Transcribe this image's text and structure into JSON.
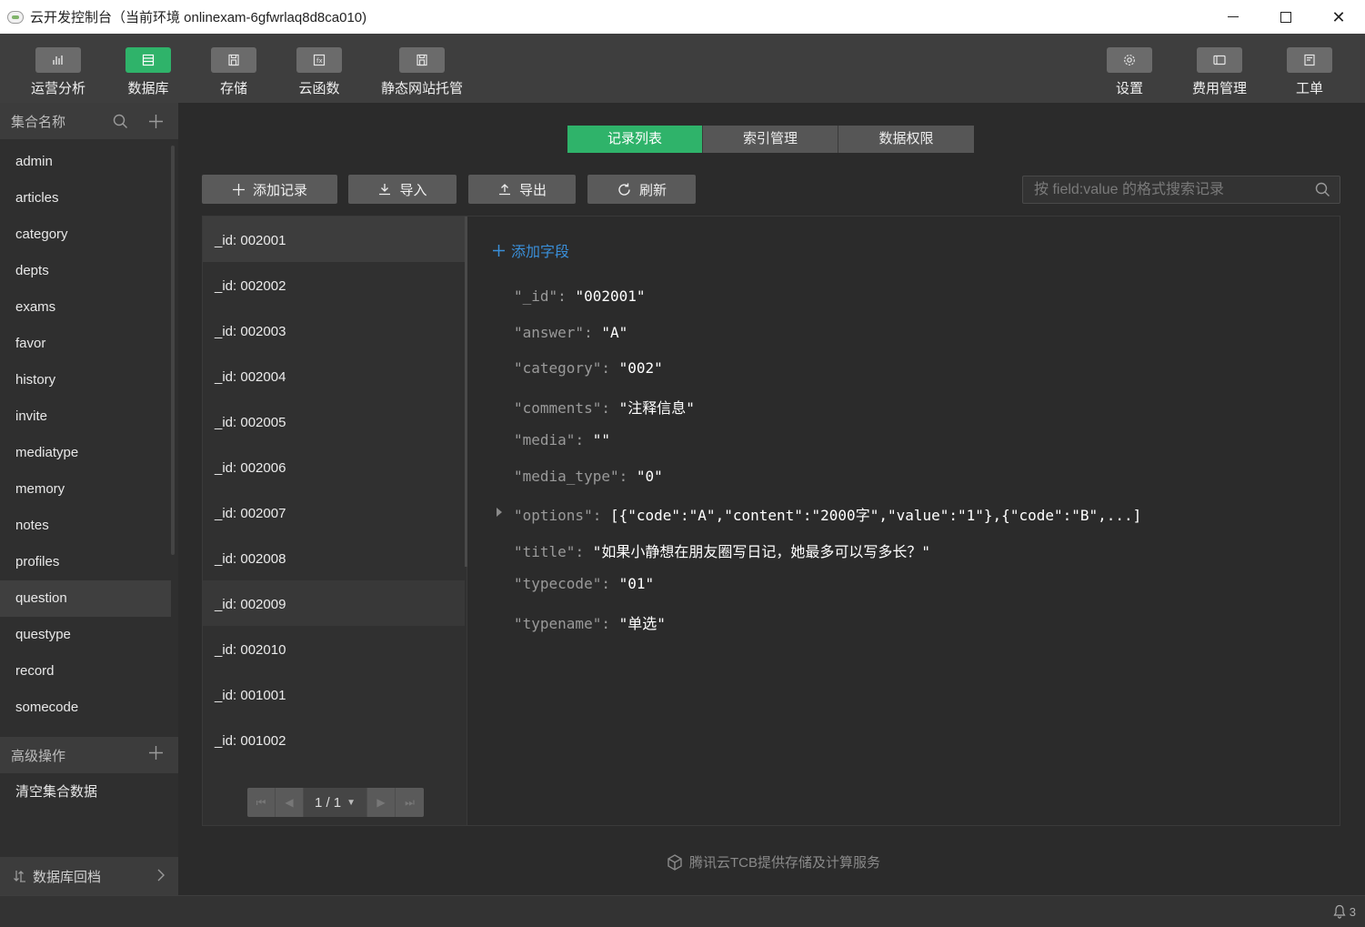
{
  "window": {
    "title": "云开发控制台（当前环境 onlinexam-6gfwrlaq8d8ca010)"
  },
  "toolbar": {
    "items": [
      {
        "label": "运营分析",
        "icon": "bar-chart-icon"
      },
      {
        "label": "数据库",
        "icon": "database-icon",
        "active": true
      },
      {
        "label": "存储",
        "icon": "storage-icon"
      },
      {
        "label": "云函数",
        "icon": "function-icon"
      },
      {
        "label": "静态网站托管",
        "icon": "hosting-icon"
      },
      {
        "label": "设置",
        "icon": "gear-icon"
      },
      {
        "label": "费用管理",
        "icon": "billing-icon"
      },
      {
        "label": "工单",
        "icon": "ticket-icon"
      }
    ]
  },
  "sidebar": {
    "header": "集合名称",
    "collections": [
      "admin",
      "articles",
      "category",
      "depts",
      "exams",
      "favor",
      "history",
      "invite",
      "mediatype",
      "memory",
      "notes",
      "profiles",
      "question",
      "questype",
      "record",
      "somecode"
    ],
    "selected": "question",
    "advanced_header": "高级操作",
    "advanced_item": "清空集合数据",
    "backup": "数据库回档"
  },
  "tabs": [
    "记录列表",
    "索引管理",
    "数据权限"
  ],
  "actions": {
    "add": "添加记录",
    "import": "导入",
    "export": "导出",
    "refresh": "刷新"
  },
  "search": {
    "placeholder": "按 field:value 的格式搜索记录"
  },
  "records": [
    "_id: 002001",
    "_id: 002002",
    "_id: 002003",
    "_id: 002004",
    "_id: 002005",
    "_id: 002006",
    "_id: 002007",
    "_id: 002008",
    "_id: 002009",
    "_id: 002010",
    "_id: 001001",
    "_id: 001002"
  ],
  "pager": {
    "current": "1 / 1"
  },
  "detail": {
    "add_field": "添加字段",
    "fields": [
      {
        "key": "\"_id\"",
        "value": "\"002001\""
      },
      {
        "key": "\"answer\"",
        "value": "\"A\""
      },
      {
        "key": "\"category\"",
        "value": "\"002\""
      },
      {
        "key": "\"comments\"",
        "value": "\"注释信息\""
      },
      {
        "key": "\"media\"",
        "value": "\"\""
      },
      {
        "key": "\"media_type\"",
        "value": "\"0\""
      },
      {
        "key": "\"options\"",
        "value": "[{\"code\":\"A\",\"content\":\"2000字\",\"value\":\"1\"},{\"code\":\"B\",...]"
      },
      {
        "key": "\"title\"",
        "value": "\"如果小静想在朋友圈写日记，她最多可以写多长？\""
      },
      {
        "key": "\"typecode\"",
        "value": "\"01\""
      },
      {
        "key": "\"typename\"",
        "value": "\"单选\""
      }
    ]
  },
  "footer": {
    "note": "腾讯云TCB提供存储及计算服务"
  },
  "status": {
    "notifications": "3"
  },
  "colors": {
    "accent": "#2fb36a",
    "link": "#3a8fd9",
    "bg": "#2b2b2b"
  }
}
